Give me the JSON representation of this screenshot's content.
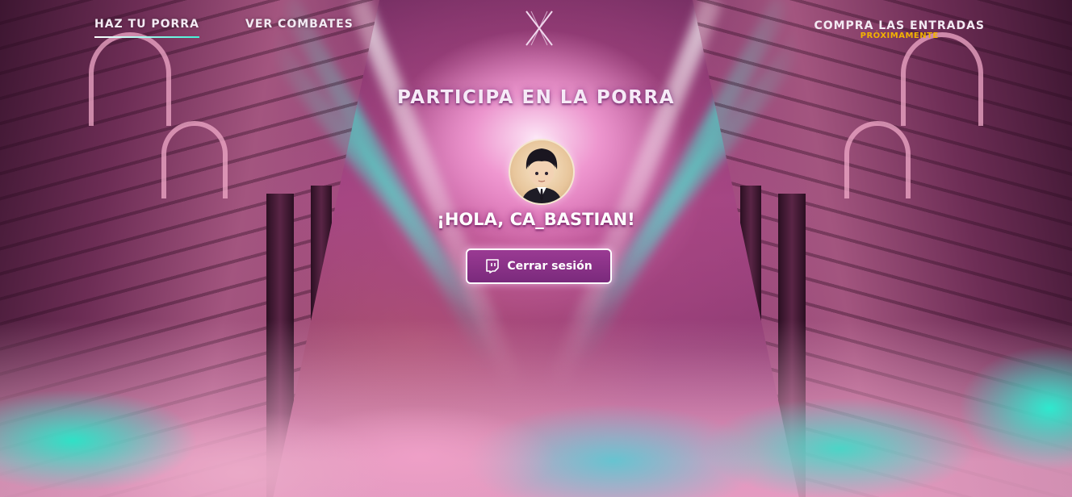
{
  "nav": {
    "left_items": [
      {
        "label": "HAZ TU PORRA",
        "active": true
      },
      {
        "label": "VER COMBATES",
        "active": false
      }
    ],
    "logo_icon": "x-logo-icon",
    "tickets": {
      "label": "COMPRA LAS ENTRADAS",
      "sublabel": "PRÓXIMAMENTE",
      "sublabel_color": "#f2b200"
    }
  },
  "main": {
    "title": "PARTICIPA EN LA PORRA",
    "avatar_icon": "user-avatar",
    "greeting": "¡HOLA, CA_BASTIAN!",
    "logout": {
      "icon": "twitch-icon",
      "label": "Cerrar sesión"
    }
  },
  "colors": {
    "accent_teal": "#3ff1d6",
    "button_purple": "#8a3288",
    "nav_text": "#f3eaf3"
  }
}
